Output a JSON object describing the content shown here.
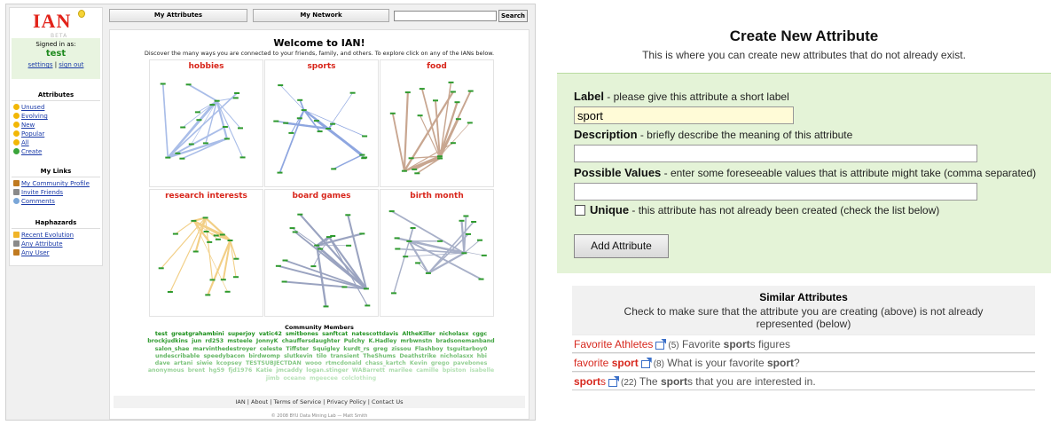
{
  "left": {
    "logo": "IAN",
    "beta": "BETA",
    "signed_in_label": "Signed in as:",
    "username": "test",
    "settings": "settings",
    "sign_out": "sign out",
    "sections": [
      {
        "heading": "Attributes",
        "items": [
          {
            "label": "Unused",
            "icon": "sun-icon",
            "color": "#f2b705"
          },
          {
            "label": "Evolving",
            "icon": "sun-icon",
            "color": "#f2b705"
          },
          {
            "label": "New",
            "icon": "sun-icon",
            "color": "#f2b705"
          },
          {
            "label": "Popular",
            "icon": "sun-icon",
            "color": "#f2b705"
          },
          {
            "label": "All",
            "icon": "sun-icon",
            "color": "#f2b705"
          },
          {
            "label": "Create",
            "icon": "plus-circle-icon",
            "color": "#3aa53a"
          }
        ]
      },
      {
        "heading": "My Links",
        "items": [
          {
            "label": "My Community Profile",
            "icon": "user-icon",
            "color": "#c07a20"
          },
          {
            "label": "Invite Friends",
            "icon": "envelope-icon",
            "color": "#8a8a8a"
          },
          {
            "label": "Comments",
            "icon": "comment-icon",
            "color": "#7aa6d8"
          }
        ]
      },
      {
        "heading": "Haphazards",
        "items": [
          {
            "label": "Recent Evolution",
            "icon": "lightning-icon",
            "color": "#f0b428"
          },
          {
            "label": "Any Attribute",
            "icon": "grid-icon",
            "color": "#8a8a8a"
          },
          {
            "label": "Any User",
            "icon": "user-icon",
            "color": "#c07a20"
          }
        ]
      }
    ],
    "topbar": {
      "my_attributes": "My Attributes",
      "my_network": "My Network",
      "search_button": "Search",
      "search_value": ""
    },
    "welcome_title": "Welcome to IAN!",
    "welcome_sub": "Discover the many ways you are connected to your friends, family, and others. To explore click on any of the IANs below.",
    "ians": [
      {
        "title": "hobbies",
        "edge_color": "#a9bde8"
      },
      {
        "title": "sports",
        "edge_color": "#8ea6e0"
      },
      {
        "title": "food",
        "edge_color": "#c8a690"
      },
      {
        "title": "research interests",
        "edge_color": "#f2cf86"
      },
      {
        "title": "board games",
        "edge_color": "#9aa3c0"
      },
      {
        "title": "birth month",
        "edge_color": "#a8b0c8"
      }
    ],
    "community_title": "Community Members",
    "community_members": [
      "test",
      "greatgrahambini",
      "superjoy",
      "vatic42",
      "smitbones",
      "sanftcat",
      "natescottdavis",
      "AltheKiller",
      "nicholasx",
      "cggc",
      "brockjudkins",
      "jun",
      "rd253",
      "msteele",
      "JonnyK",
      "chauffersdaughter",
      "Pulchy",
      "K.Hadley",
      "mrbwnstn",
      "bradsonemanband",
      "salon_shae",
      "marvinthedestroyer",
      "celeste",
      "Tiffster",
      "Squigley",
      "kurdt_rs",
      "greg",
      "zissou",
      "Flashboy",
      "tsguitarboy0",
      "undescribable",
      "speedybacon",
      "birdwomp",
      "slutkevin",
      "tilo",
      "transient",
      "TheShums",
      "Deathstrike",
      "nicholasxx",
      "hbi",
      "dave",
      "artani",
      "siwie",
      "kcopsey",
      "TESTSUBJECTDAN",
      "wooo",
      "rtmcdonald",
      "chass_kartch",
      "Kevin",
      "grego",
      "pavebones",
      "anonymous",
      "brent",
      "hg59",
      "fjd1976",
      "Katie",
      "jmcaddy",
      "logan.stinger",
      "WABarrett",
      "marilee",
      "camille",
      "bpiston",
      "isabelle",
      "jimb",
      "oceane",
      "mgeecee",
      "colclothing"
    ],
    "footer_links": "IAN | About | Terms of Service | Privacy Policy | Contact Us",
    "copyright": "© 2008 BYU Data Mining Lab — Matt Smith"
  },
  "right": {
    "title": "Create New Attribute",
    "subtitle": "This is where you can create new attributes that do not already exist.",
    "label_field": {
      "name": "Label",
      "hint": " - please give this attribute a short label",
      "value": "sport"
    },
    "description_field": {
      "name": "Description",
      "hint": " - briefly describe the meaning of this attribute",
      "value": ""
    },
    "values_field": {
      "name": "Possible Values",
      "hint": " - enter some foreseeable values that is attribute might take (comma separated)",
      "value": ""
    },
    "unique": {
      "name": "Unique",
      "hint": " - this attribute has not already been created (check the list below)",
      "checked": false
    },
    "add_button": "Add Attribute",
    "similar": {
      "heading": "Similar Attributes",
      "desc_line1": "Check to make sure that the attribute you are creating (above) is not already",
      "desc_line2": "represented (below)",
      "rows": [
        {
          "name": "Favorite Athletes",
          "count": "(5)",
          "desc_pre": "Favorite ",
          "desc_bold": "sport",
          "desc_post": "s figures"
        },
        {
          "name_pre": "favorite ",
          "name_bold": "sport",
          "count": "(8)",
          "desc_pre": "What is your favorite ",
          "desc_bold": "sport",
          "desc_post": "?"
        },
        {
          "name_bold": "sport",
          "name_post": "s",
          "count": "(22)",
          "desc_pre": "The ",
          "desc_bold": "sport",
          "desc_post": "s that you are interested in."
        }
      ]
    }
  }
}
